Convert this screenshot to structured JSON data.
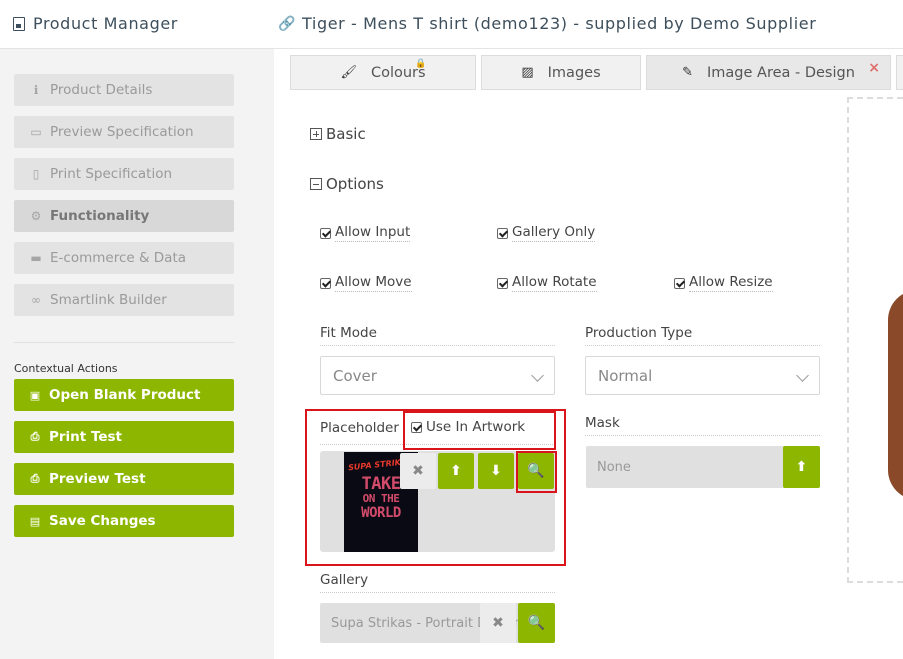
{
  "header": {
    "app_title": "Product Manager",
    "product_title": "Tiger - Mens T shirt (demo123) - supplied by Demo Supplier"
  },
  "sidebar": {
    "items": [
      {
        "label": "Product Details",
        "icon": "info-icon"
      },
      {
        "label": "Preview Specification",
        "icon": "monitor-icon"
      },
      {
        "label": "Print Specification",
        "icon": "pdf-file-icon"
      },
      {
        "label": "Functionality",
        "icon": "cogs-icon"
      },
      {
        "label": "E-commerce & Data",
        "icon": "credit-card-icon"
      },
      {
        "label": "Smartlink Builder",
        "icon": "link-icon"
      }
    ],
    "contextual_label": "Contextual Actions",
    "actions": [
      {
        "label": "Open Blank Product",
        "icon": "play-square-icon"
      },
      {
        "label": "Print Test",
        "icon": "printer-icon"
      },
      {
        "label": "Preview Test",
        "icon": "printer-icon"
      },
      {
        "label": "Save Changes",
        "icon": "floppy-disk-icon"
      }
    ]
  },
  "tabs": [
    {
      "label": "Colours",
      "icon": "brush-icon"
    },
    {
      "label": "Images",
      "icon": "image-icon"
    },
    {
      "label": "Image Area - Design",
      "icon": "edit-icon",
      "close": "×"
    }
  ],
  "sections": {
    "basic": "Basic",
    "options": "Options"
  },
  "options": {
    "allow_input": "Allow Input",
    "gallery_only": "Gallery Only",
    "allow_move": "Allow Move",
    "allow_rotate": "Allow Rotate",
    "allow_resize": "Allow Resize"
  },
  "fit_mode": {
    "label": "Fit Mode",
    "value": "Cover"
  },
  "production_type": {
    "label": "Production Type",
    "value": "Normal"
  },
  "placeholder": {
    "label": "Placeholder",
    "use_in_artwork": "Use In Artwork",
    "thumb_top": "SUPA STRIKAS",
    "thumb_line1": "TAKE",
    "thumb_line2": "ON THE",
    "thumb_line3": "WORLD"
  },
  "mask": {
    "label": "Mask",
    "value": "None"
  },
  "gallery": {
    "label": "Gallery",
    "value": "Supa Strikas - Portrait Designs"
  },
  "colors": {
    "accent": "#8db600",
    "highlight": "#d9141a"
  }
}
